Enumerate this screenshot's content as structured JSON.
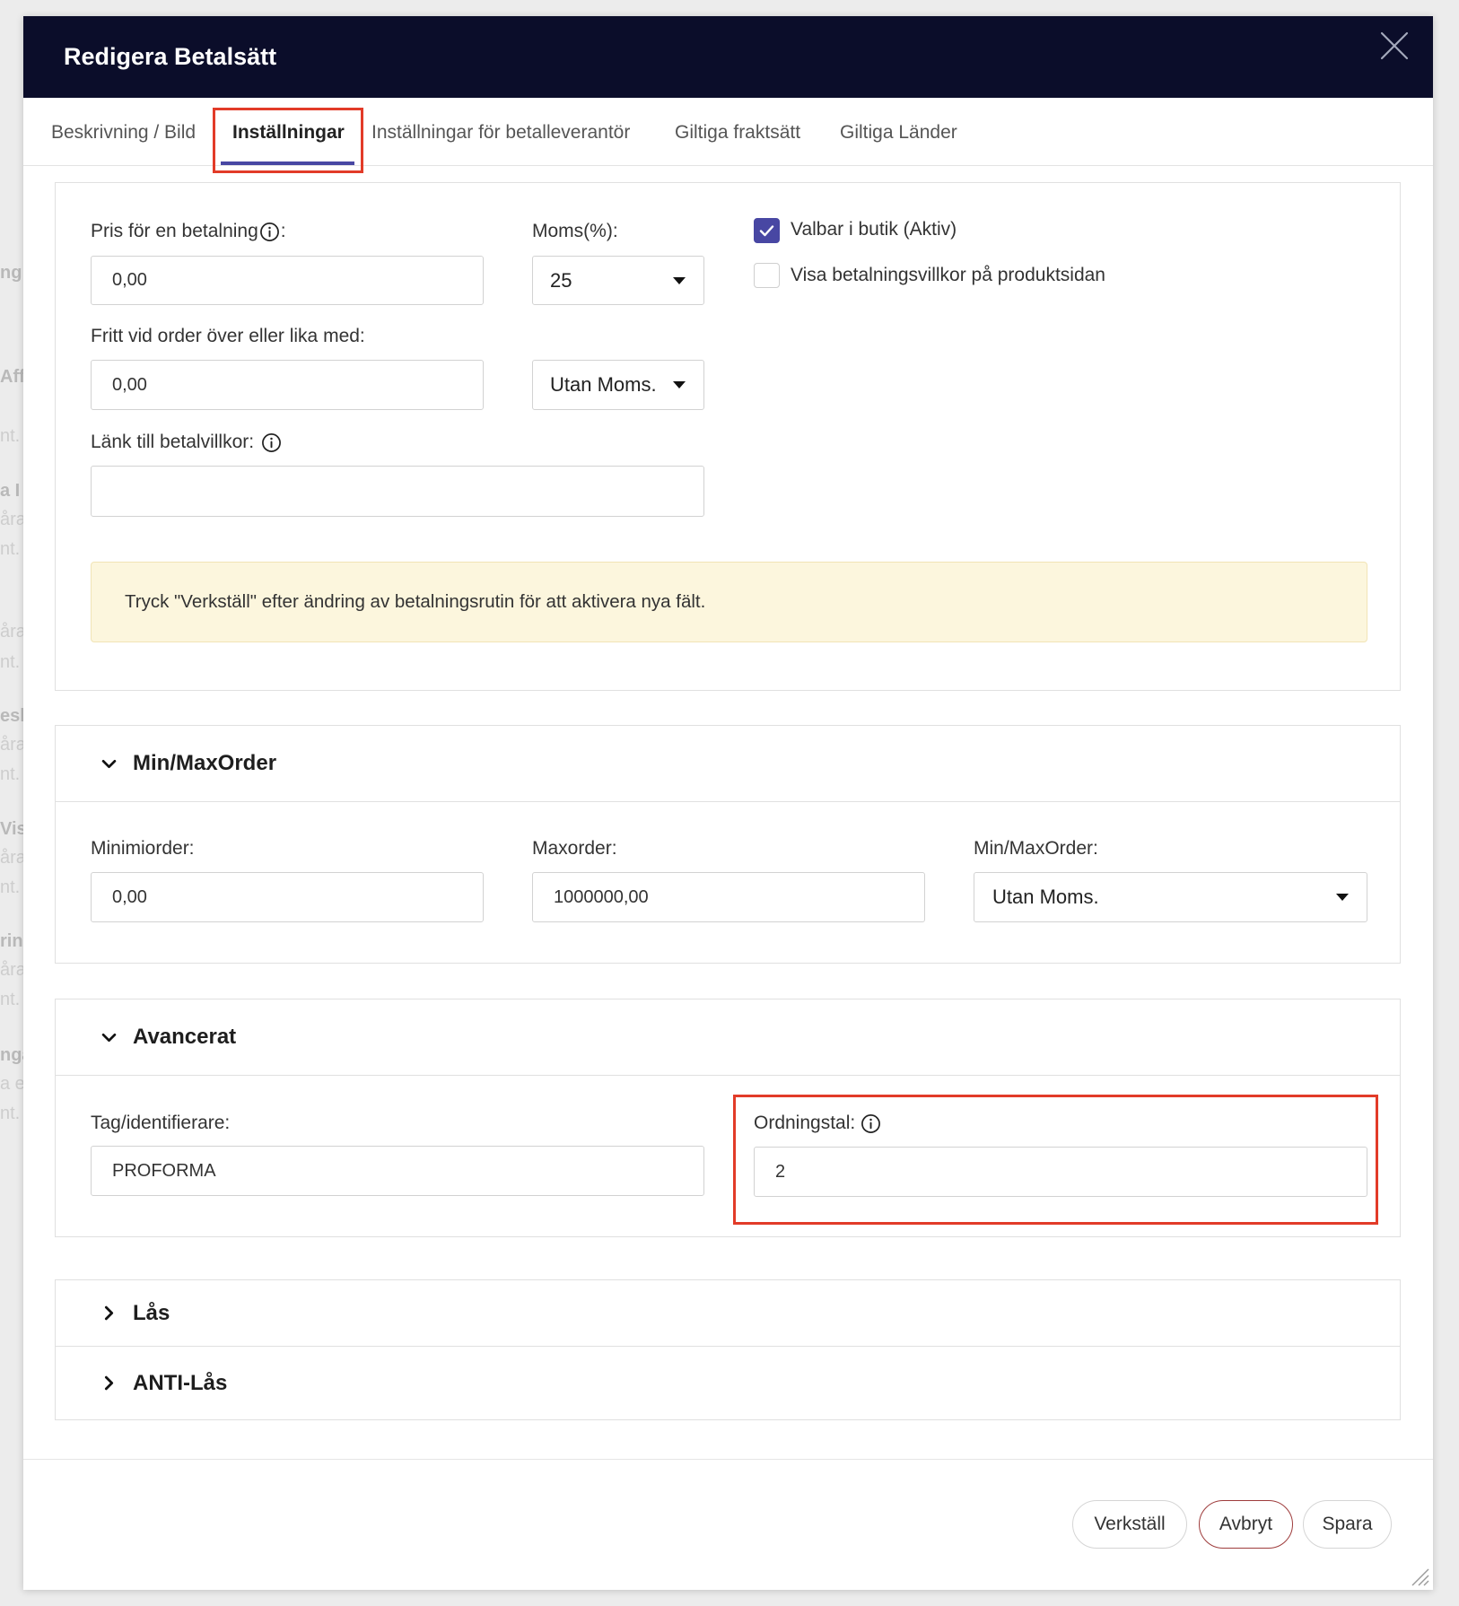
{
  "background_fragments": [
    "ng",
    "Affi",
    "nt.",
    "a I",
    "åra",
    "nt.",
    "åra",
    "nt.",
    "esk",
    "åra",
    "nt.",
    "Visa",
    "åra",
    "nt.",
    "rin",
    "åra",
    "nt.",
    "nga",
    "a e",
    "nt."
  ],
  "modal": {
    "title": "Redigera Betalsätt",
    "close_icon": "close-icon"
  },
  "tabs": [
    {
      "label": "Beskrivning / Bild",
      "active": false
    },
    {
      "label": "Inställningar",
      "active": true
    },
    {
      "label": "Inställningar för betalleverantör",
      "active": false
    },
    {
      "label": "Giltiga fraktsätt",
      "active": false
    },
    {
      "label": "Giltiga Länder",
      "active": false
    }
  ],
  "general": {
    "price_label": "Pris för en betalning",
    "price_label_suffix": ":",
    "price_value": "0,00",
    "vat_label": "Moms(%):",
    "vat_selected": "25",
    "free_label": "Fritt vid order över eller lika med:",
    "free_value": "0,00",
    "free_vat_selected": "Utan Moms.",
    "terms_link_label": "Länk till betalvillkor:",
    "terms_link_value": "",
    "active_checkbox": {
      "label": "Valbar i butik (Aktiv)",
      "checked": true
    },
    "show_terms_checkbox": {
      "label": "Visa betalningsvillkor på produktsidan",
      "checked": false
    },
    "notice": "Tryck \"Verkställ\" efter ändring av betalningsrutin för att aktivera nya fält."
  },
  "minmax": {
    "title": "Min/MaxOrder",
    "expanded": true,
    "min_label": "Minimiorder:",
    "min_value": "0,00",
    "max_label": "Maxorder:",
    "max_value": "1000000,00",
    "vat_label": "Min/MaxOrder:",
    "vat_selected": "Utan Moms."
  },
  "advanced": {
    "title": "Avancerat",
    "expanded": true,
    "tag_label": "Tag/identifierare:",
    "tag_value": "PROFORMA",
    "order_label": "Ordningstal:",
    "order_value": "2"
  },
  "collapsed_sections": [
    {
      "title": "Lås",
      "expanded": false
    },
    {
      "title": "ANTI-Lås",
      "expanded": false
    }
  ],
  "footer": {
    "apply": "Verkställ",
    "cancel": "Avbryt",
    "save": "Spara"
  },
  "icons": {
    "close": "close-icon",
    "info": "info-icon",
    "expanded": "chevron-down-icon",
    "collapsed": "chevron-right-icon",
    "select": "caret-down-icon",
    "check": "check-icon",
    "resize": "resize-handle-icon"
  },
  "colors": {
    "header_bg": "#0b0d2a",
    "accent": "#4847a3",
    "highlight": "#e23b28",
    "notice_bg": "#fcf6dd",
    "cancel_border": "#9e3c3c"
  }
}
